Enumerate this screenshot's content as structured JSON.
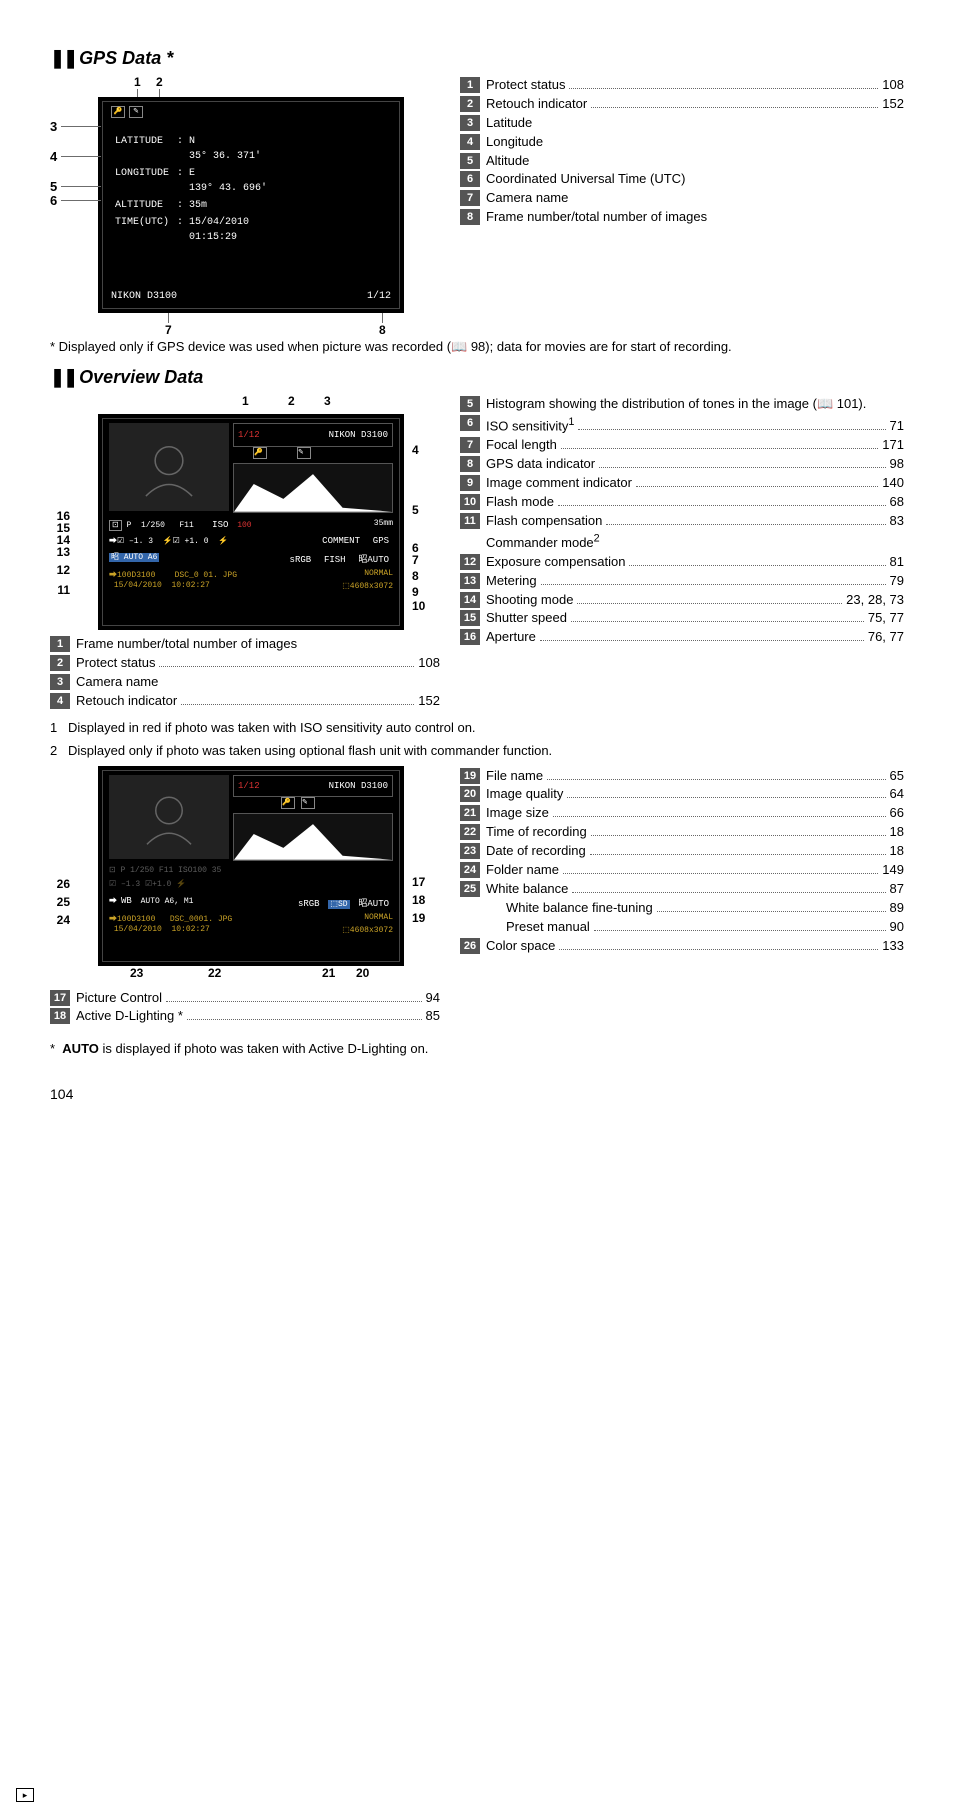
{
  "gps": {
    "title": "GPS Data *",
    "screen": {
      "lat_label": "LATITUDE",
      "lat_ns": "N",
      "lat_val": "35° 36. 371'",
      "lon_label": "LONGITUDE",
      "lon_ew": "E",
      "lon_val": "139° 43. 696'",
      "alt_label": "ALTITUDE",
      "alt_val": "35m",
      "time_label": "TIME(UTC)",
      "time_date": "15/04/2010",
      "time_val": "01:15:29",
      "camera": "NIKON D3100",
      "counter": "1/12"
    },
    "refs": [
      {
        "n": "1",
        "label": "Protect status",
        "pg": "108"
      },
      {
        "n": "2",
        "label": "Retouch indicator ",
        "pg": "152"
      },
      {
        "n": "3",
        "label": "Latitude"
      },
      {
        "n": "4",
        "label": "Longitude"
      },
      {
        "n": "5",
        "label": "Altitude"
      },
      {
        "n": "6",
        "label": "Coordinated Universal Time (UTC)"
      },
      {
        "n": "7",
        "label": "Camera name"
      },
      {
        "n": "8",
        "label": "Frame number/total number of images"
      }
    ],
    "note": "*  Displayed only if GPS device was used when picture was recorded (📖 98); data for movies are for start of recording."
  },
  "overview": {
    "title": "Overview Data",
    "screen1": {
      "counter": "1/12",
      "camera": "NIKON D3100",
      "mode": "P",
      "shutter": "1/250",
      "aperture": "F11",
      "iso_tag": "ISO",
      "iso": "100",
      "focal": "35mm",
      "exp_comp": "–1. 3",
      "flash_comp": "+1. 0",
      "comment": "COMMENT",
      "gps": "GPS",
      "adl": "AUTO A6",
      "adl_lbl": "",
      "fish": "FISH",
      "wb_auto": "AUTO",
      "folder": "100D3100",
      "file": "DSC_0   01.  JPG",
      "normal": "NORMAL",
      "date": "15/04/2010",
      "time": "10:02:27",
      "dims": "4608x3072"
    },
    "refs_left_under": [
      {
        "n": "1",
        "label": "Frame number/total number of images"
      },
      {
        "n": "2",
        "label": "Protect status",
        "pg": "108"
      },
      {
        "n": "3",
        "label": "Camera name"
      },
      {
        "n": "4",
        "label": "Retouch indicator",
        "pg": "152"
      }
    ],
    "refs_right": [
      {
        "n": "5",
        "label": "Histogram showing the distribution of tones in the image (📖 101)."
      },
      {
        "n": "6",
        "label": "ISO sensitivity",
        "sup": "1",
        "pg": "71"
      },
      {
        "n": "7",
        "label": "Focal length ",
        "pg": "171"
      },
      {
        "n": "8",
        "label": "GPS data indicator",
        "pg": "98"
      },
      {
        "n": "9",
        "label": "Image comment indicator",
        "pg": "140"
      },
      {
        "n": "10",
        "label": "Flash mode",
        "pg": "68"
      },
      {
        "n": "11",
        "label": "Flash compensation",
        "pg": "83"
      },
      {
        "n": "11b",
        "label": "Commander mode",
        "sup": "2"
      },
      {
        "n": "12",
        "label": "Exposure compensation",
        "pg": "81"
      },
      {
        "n": "13",
        "label": "Metering",
        "pg": "79"
      },
      {
        "n": "14",
        "label": "Shooting mode",
        "pg": "23, 28, 73"
      },
      {
        "n": "15",
        "label": "Shutter speed",
        "pg": "75, 77"
      },
      {
        "n": "16",
        "label": "Aperture",
        "pg": "76, 77"
      }
    ],
    "footnotes": [
      {
        "n": "1",
        "text": "Displayed in red if photo was taken with ISO sensitivity auto control on."
      },
      {
        "n": "2",
        "text": "Displayed only if photo was taken using optional flash unit with commander function."
      }
    ],
    "screen2": {
      "counter": "1/12",
      "camera": "NIKON D3100",
      "wb_line": "AUTO A6, M1",
      "srgb": "sRGB",
      "sd": "SD",
      "flash_auto": "AUTO",
      "folder": "100D3100",
      "file": "DSC_0001. JPG",
      "normal": "NORMAL",
      "date": "15/04/2010",
      "time": "10:02:27",
      "dims": "4608x3072",
      "wb_icon": "WB"
    },
    "refs_bl": [
      {
        "n": "17",
        "label": "Picture Control",
        "pg": "94"
      },
      {
        "n": "18",
        "label": "Active D-Lighting *",
        "pg": "85"
      }
    ],
    "refs_br": [
      {
        "n": "19",
        "label": "File name",
        "pg": "65"
      },
      {
        "n": "20",
        "label": "Image quality ",
        "pg": "64"
      },
      {
        "n": "21",
        "label": "Image size",
        "pg": "66"
      },
      {
        "n": "22",
        "label": "Time of recording",
        "pg": "18"
      },
      {
        "n": "23",
        "label": "Date of recording",
        "pg": "18"
      },
      {
        "n": "24",
        "label": "Folder name",
        "pg": "149"
      },
      {
        "n": "25",
        "label": "White balance ",
        "pg": "87"
      },
      {
        "n": "25a",
        "label": "White balance fine-tuning",
        "pg": "89",
        "indent": true
      },
      {
        "n": "25b",
        "label": "Preset manual",
        "pg": "90",
        "indent": true
      },
      {
        "n": "26",
        "label": "Color space",
        "pg": "133"
      }
    ],
    "star_note": "*  AUTO is displayed if photo was taken with Active D-Lighting on.",
    "auto_bold": "AUTO"
  },
  "page_number": "104"
}
